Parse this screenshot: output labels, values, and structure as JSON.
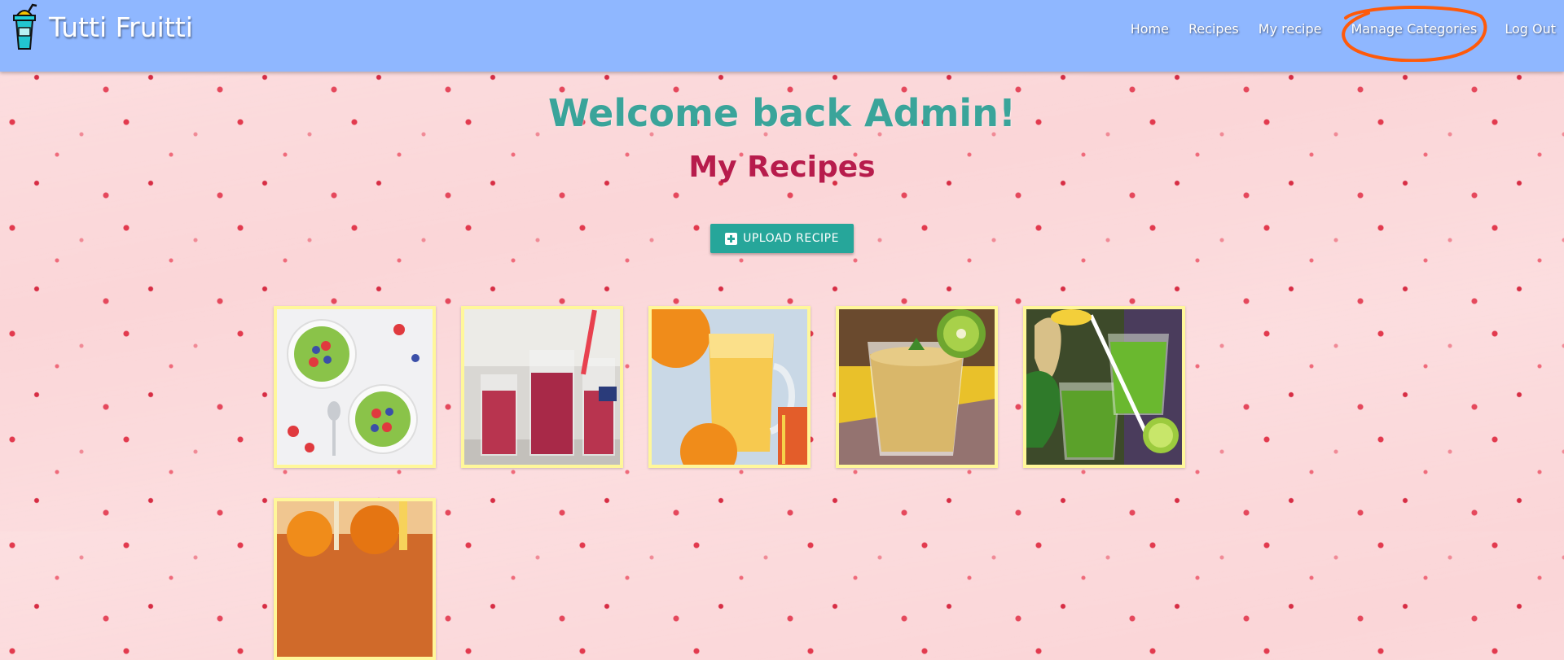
{
  "brand": {
    "title": "Tutti Fruitti",
    "logo_icon": "smoothie-cup-icon"
  },
  "nav": {
    "items": [
      {
        "label": "Home"
      },
      {
        "label": "Recipes"
      },
      {
        "label": "My recipe"
      },
      {
        "label": "Manage Categories",
        "annotated": true
      },
      {
        "label": "Log Out"
      }
    ]
  },
  "main": {
    "welcome": "Welcome back Admin!",
    "heading": "My Recipes",
    "upload_label": "UPLOAD RECIPE",
    "upload_icon": "plus-square-icon"
  },
  "recipes": [
    {
      "image": "green-smoothie-bowls-with-berries"
    },
    {
      "image": "berry-smoothie-glasses"
    },
    {
      "image": "orange-smoothie-mug"
    },
    {
      "image": "kiwi-smoothie-glass"
    },
    {
      "image": "green-ginger-smoothie"
    },
    {
      "image": "orange-smoothie-partial"
    }
  ],
  "colors": {
    "navbar": "#8fb7ff",
    "welcome": "#3aa49a",
    "heading": "#b71c4c",
    "button": "#26a69a",
    "card_border": "#fff79a",
    "annotation": "#ff5a0a"
  }
}
